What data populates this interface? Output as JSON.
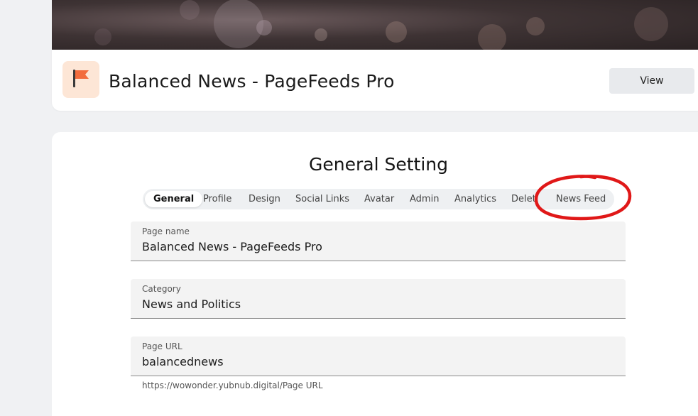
{
  "header": {
    "title": "Balanced News - PageFeeds Pro",
    "view_label": "View",
    "avatar_icon": "flag-icon",
    "avatar_color": "#f26c3d"
  },
  "settings": {
    "title": "General Setting",
    "tabs": [
      {
        "label": "General",
        "active": true
      },
      {
        "label": "Profile"
      },
      {
        "label": "Design"
      },
      {
        "label": "Social Links"
      },
      {
        "label": "Avatar"
      },
      {
        "label": "Admin"
      },
      {
        "label": "Analytics"
      },
      {
        "label": "Delet"
      },
      {
        "label": "News Feed"
      }
    ],
    "fields": {
      "page_name": {
        "label": "Page name",
        "value": "Balanced News - PageFeeds Pro"
      },
      "category": {
        "label": "Category",
        "value": "News and Politics"
      },
      "page_url": {
        "label": "Page URL",
        "value": "balancednews",
        "helper": "https://wowonder.yubnub.digital/Page URL"
      }
    }
  },
  "colors": {
    "annotation": "#e01818",
    "background": "#f0f1f3"
  }
}
